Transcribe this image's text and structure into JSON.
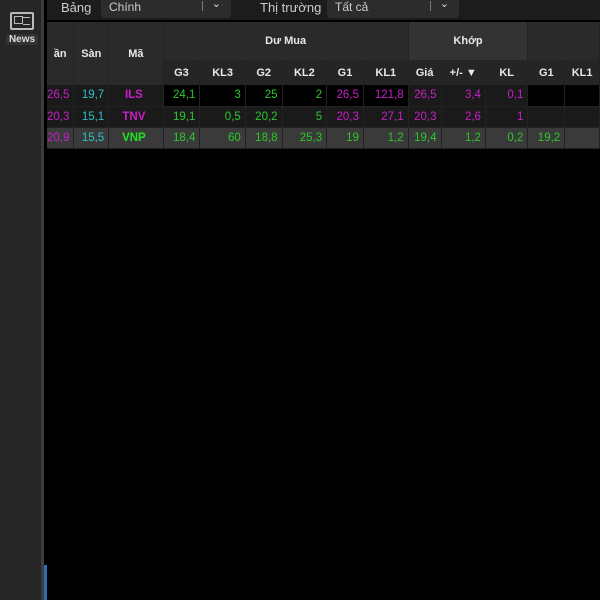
{
  "sidebar": {
    "news_label": "News",
    "icon": "newspaper-icon"
  },
  "toolbar": {
    "board_label": "Bảng",
    "board_value": "Chính",
    "market_label": "Thị trường",
    "market_value": "Tất cả"
  },
  "table": {
    "headers": {
      "tran": "ần",
      "san": "Sàn",
      "ma": "Mã",
      "du_mua": "Dư Mua",
      "khop": "Khớp"
    },
    "sub_headers": [
      "G3",
      "KL3",
      "G2",
      "KL2",
      "G1",
      "KL1",
      "Giá",
      "+/- ▼",
      "KL",
      "G1",
      "KL1"
    ],
    "rows": [
      {
        "tran": "26,5",
        "san": "19,7",
        "ma": "ILS",
        "g3": "24,1",
        "kl3": "3",
        "g2": "25",
        "kl2": "2",
        "g1": "26,5",
        "kl1": "121,8",
        "gia": "26,5",
        "chg": "3,4",
        "kl": "0,1",
        "bg1": "",
        "bkl1": ""
      },
      {
        "tran": "20,3",
        "san": "15,1",
        "ma": "TNV",
        "g3": "19,1",
        "kl3": "0,5",
        "g2": "20,2",
        "kl2": "5",
        "g1": "20,3",
        "kl1": "27,1",
        "gia": "20,3",
        "chg": "2,6",
        "kl": "1",
        "bg1": "",
        "bkl1": ""
      },
      {
        "tran": "20,9",
        "san": "15,5",
        "ma": "VNP",
        "g3": "18,4",
        "kl3": "60",
        "g2": "18,8",
        "kl2": "25,3",
        "g1": "19",
        "kl1": "1,2",
        "gia": "19,4",
        "chg": "1,2",
        "kl": "0,2",
        "bg1": "19,2",
        "bkl1": ""
      }
    ]
  }
}
